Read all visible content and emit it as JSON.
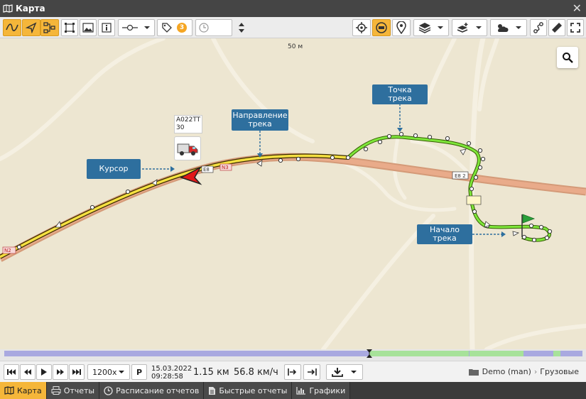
{
  "window": {
    "title": "Карта"
  },
  "toolbar": {
    "counter_badge": "3",
    "time_value": ""
  },
  "map": {
    "scale": "50 м",
    "unit": {
      "name": "A022TT",
      "sub": "30"
    },
    "callouts": {
      "cursor": "Курсор",
      "direction": "Направление трека",
      "point": "Точка трека",
      "start": "Начало трека"
    },
    "road_labels": {
      "e8_a": "E8",
      "e8_2": "E8 2",
      "n2": "N2",
      "n3": "N3"
    }
  },
  "playback": {
    "speed": "1200x",
    "p_label": "P",
    "date": "15.03.2022",
    "time": "09:28:58",
    "distance": "1.15 км",
    "velocity": "56.8 км/ч",
    "path": {
      "user": "Demo (man)",
      "group": "Грузовые"
    }
  },
  "tabs": [
    {
      "label": "Карта",
      "icon": "map-icon"
    },
    {
      "label": "Отчеты",
      "icon": "printer-icon"
    },
    {
      "label": "Расписание отчетов",
      "icon": "clock-icon"
    },
    {
      "label": "Быстрые отчеты",
      "icon": "document-icon"
    },
    {
      "label": "Графики",
      "icon": "chart-icon"
    }
  ],
  "colors": {
    "accent": "#f5b63a",
    "callout": "#2e6f9e",
    "track": "#7ee63a",
    "road": "#d79a77"
  }
}
